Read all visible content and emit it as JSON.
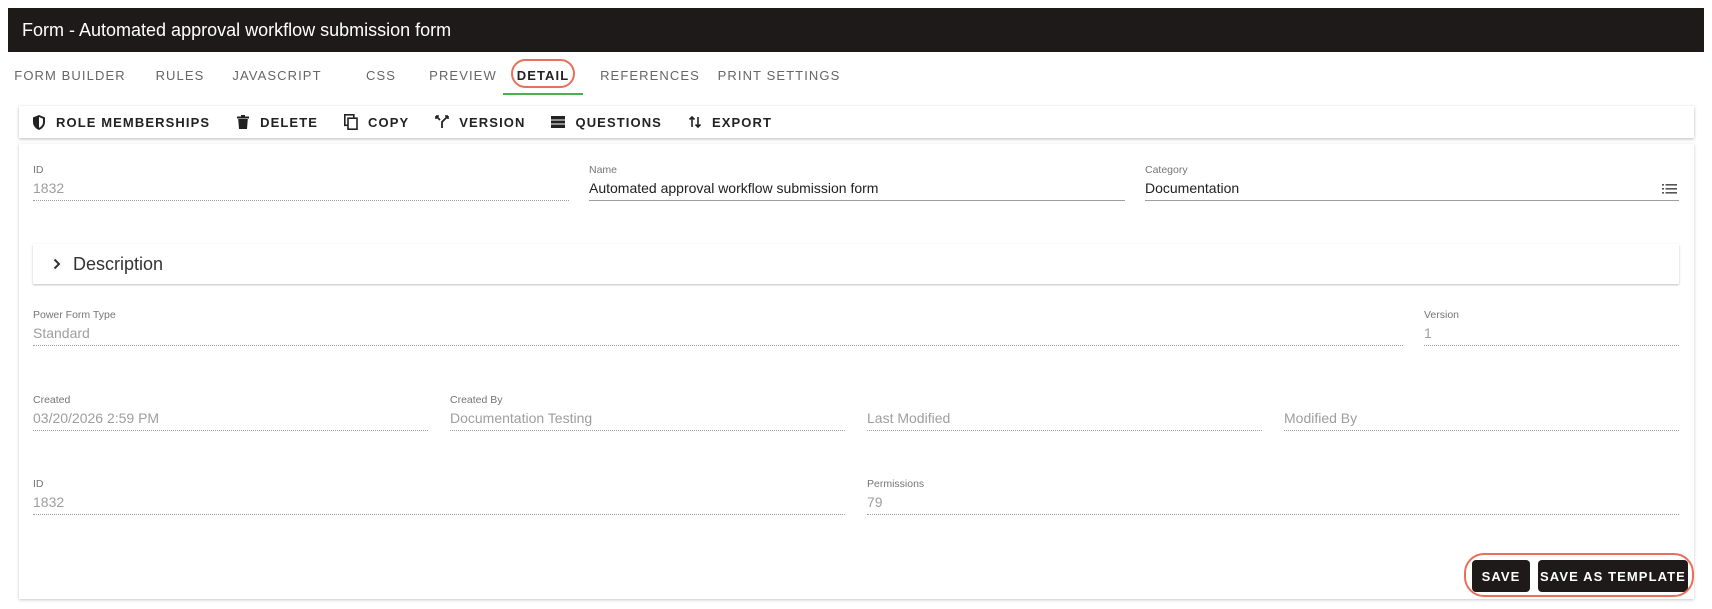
{
  "window": {
    "title": "Form - Automated approval workflow submission form"
  },
  "tabs": [
    {
      "label": "FORM BUILDER"
    },
    {
      "label": "RULES"
    },
    {
      "label": "JAVASCRIPT"
    },
    {
      "label": "CSS"
    },
    {
      "label": "PREVIEW"
    },
    {
      "label": "DETAIL"
    },
    {
      "label": "REFERENCES"
    },
    {
      "label": "PRINT SETTINGS"
    }
  ],
  "active_tab": "DETAIL",
  "toolbar": {
    "role_memberships": "ROLE MEMBERSHIPS",
    "delete": "DELETE",
    "copy": "COPY",
    "version": "VERSION",
    "questions": "QUESTIONS",
    "export": "EXPORT"
  },
  "fields": {
    "id_top": {
      "label": "ID",
      "value": "1832"
    },
    "name": {
      "label": "Name",
      "value": "Automated approval workflow submission form"
    },
    "category": {
      "label": "Category",
      "value": "Documentation"
    },
    "power_form_type": {
      "label": "Power Form Type",
      "value": "Standard"
    },
    "version": {
      "label": "Version",
      "value": "1"
    },
    "created": {
      "label": "Created",
      "value": "03/20/2026 2:59 PM"
    },
    "created_by": {
      "label": "Created By",
      "value": "Documentation Testing"
    },
    "last_modified": {
      "label": "Last Modified"
    },
    "modified_by": {
      "label": "Modified By"
    },
    "id_bottom": {
      "label": "ID",
      "value": "1832"
    },
    "permissions": {
      "label": "Permissions",
      "value": "79"
    }
  },
  "description": {
    "label": "Description"
  },
  "actions": {
    "save": "SAVE",
    "save_as_template": "SAVE AS TEMPLATE"
  },
  "colors": {
    "header_bg": "#1d1a19",
    "accent_underline": "#4caf50",
    "highlight_ring": "#e8705a"
  },
  "icons": {
    "role_memberships": "shield-icon",
    "delete": "trash-icon",
    "copy": "copy-icon",
    "version": "branch-icon",
    "questions": "list-icon",
    "export": "sort-arrows-icon",
    "category": "list-menu-icon",
    "description": "chevron-right-icon"
  }
}
